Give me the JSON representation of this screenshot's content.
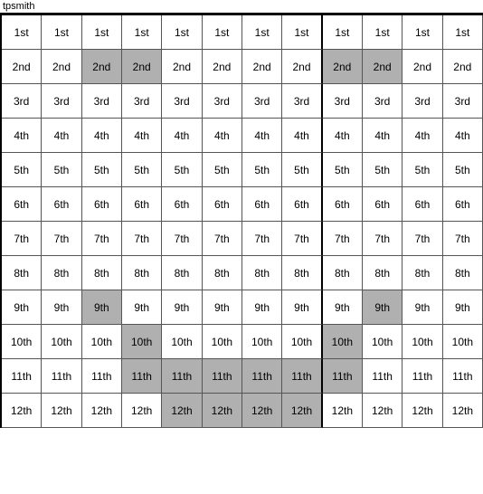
{
  "title": "tpsmith",
  "rows": [
    {
      "label": "1st",
      "highlights": [
        false,
        false,
        false,
        false,
        false,
        false,
        false,
        false,
        false,
        false,
        false,
        false
      ]
    },
    {
      "label": "2nd",
      "highlights": [
        false,
        false,
        true,
        true,
        false,
        false,
        false,
        false,
        true,
        true,
        false,
        false
      ]
    },
    {
      "label": "3rd",
      "highlights": [
        false,
        false,
        false,
        false,
        false,
        false,
        false,
        false,
        false,
        false,
        false,
        false
      ]
    },
    {
      "label": "4th",
      "highlights": [
        false,
        false,
        false,
        false,
        false,
        false,
        false,
        false,
        false,
        false,
        false,
        false
      ]
    },
    {
      "label": "5th",
      "highlights": [
        false,
        false,
        false,
        false,
        false,
        false,
        false,
        false,
        false,
        false,
        false,
        false
      ]
    },
    {
      "label": "6th",
      "highlights": [
        false,
        false,
        false,
        false,
        false,
        false,
        false,
        false,
        false,
        false,
        false,
        false
      ]
    },
    {
      "label": "7th",
      "highlights": [
        false,
        false,
        false,
        false,
        false,
        false,
        false,
        false,
        false,
        false,
        false,
        false
      ]
    },
    {
      "label": "8th",
      "highlights": [
        false,
        false,
        false,
        false,
        false,
        false,
        false,
        false,
        false,
        false,
        false,
        false
      ]
    },
    {
      "label": "9th",
      "highlights": [
        false,
        false,
        true,
        false,
        false,
        false,
        false,
        false,
        false,
        true,
        false,
        false
      ]
    },
    {
      "label": "10th",
      "highlights": [
        false,
        false,
        false,
        true,
        false,
        false,
        false,
        false,
        true,
        false,
        false,
        false
      ]
    },
    {
      "label": "11th",
      "highlights": [
        false,
        false,
        false,
        true,
        true,
        true,
        true,
        true,
        true,
        false,
        false,
        false
      ]
    },
    {
      "label": "12th",
      "highlights": [
        false,
        false,
        false,
        false,
        true,
        true,
        true,
        true,
        false,
        false,
        false,
        false
      ]
    }
  ],
  "cols": 12
}
